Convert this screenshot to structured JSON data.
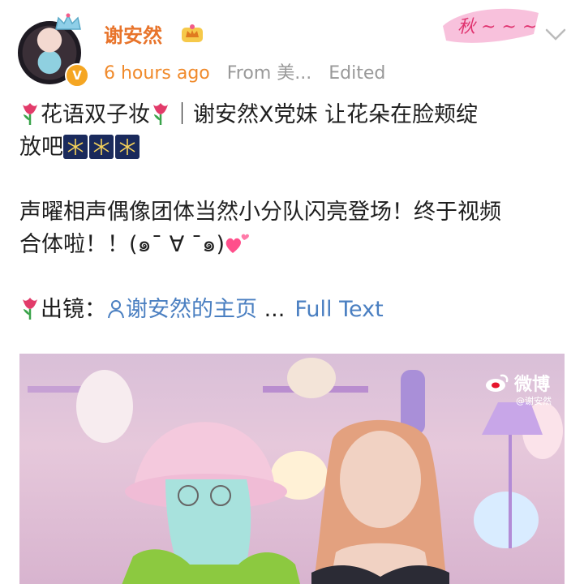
{
  "header": {
    "username": "谢安然",
    "time": "6 hours ago",
    "source": "From 美...",
    "edited": "Edited"
  },
  "post": {
    "line1_title": "花语双子妆",
    "line1_sep": "｜谢安然X党妹 让花朵在脸颊绽",
    "line2_text": "放吧",
    "para2_line1": "声曜相声偶像团体当然小分队闪亮登场！终于视频",
    "para2_line2": "合体啦！！(๑¯ ∀ ¯๑)",
    "para3_label": "出镜：",
    "para3_link": "谢安然的主页",
    "para3_ellipsis": " ...",
    "full_text": "Full Text"
  },
  "image": {
    "watermark_brand": "微博",
    "watermark_handle": "@谢安然"
  },
  "colors": {
    "username": "#e8742b",
    "time": "#f08a2b",
    "link": "#4a7fc1",
    "meta": "#999999"
  }
}
